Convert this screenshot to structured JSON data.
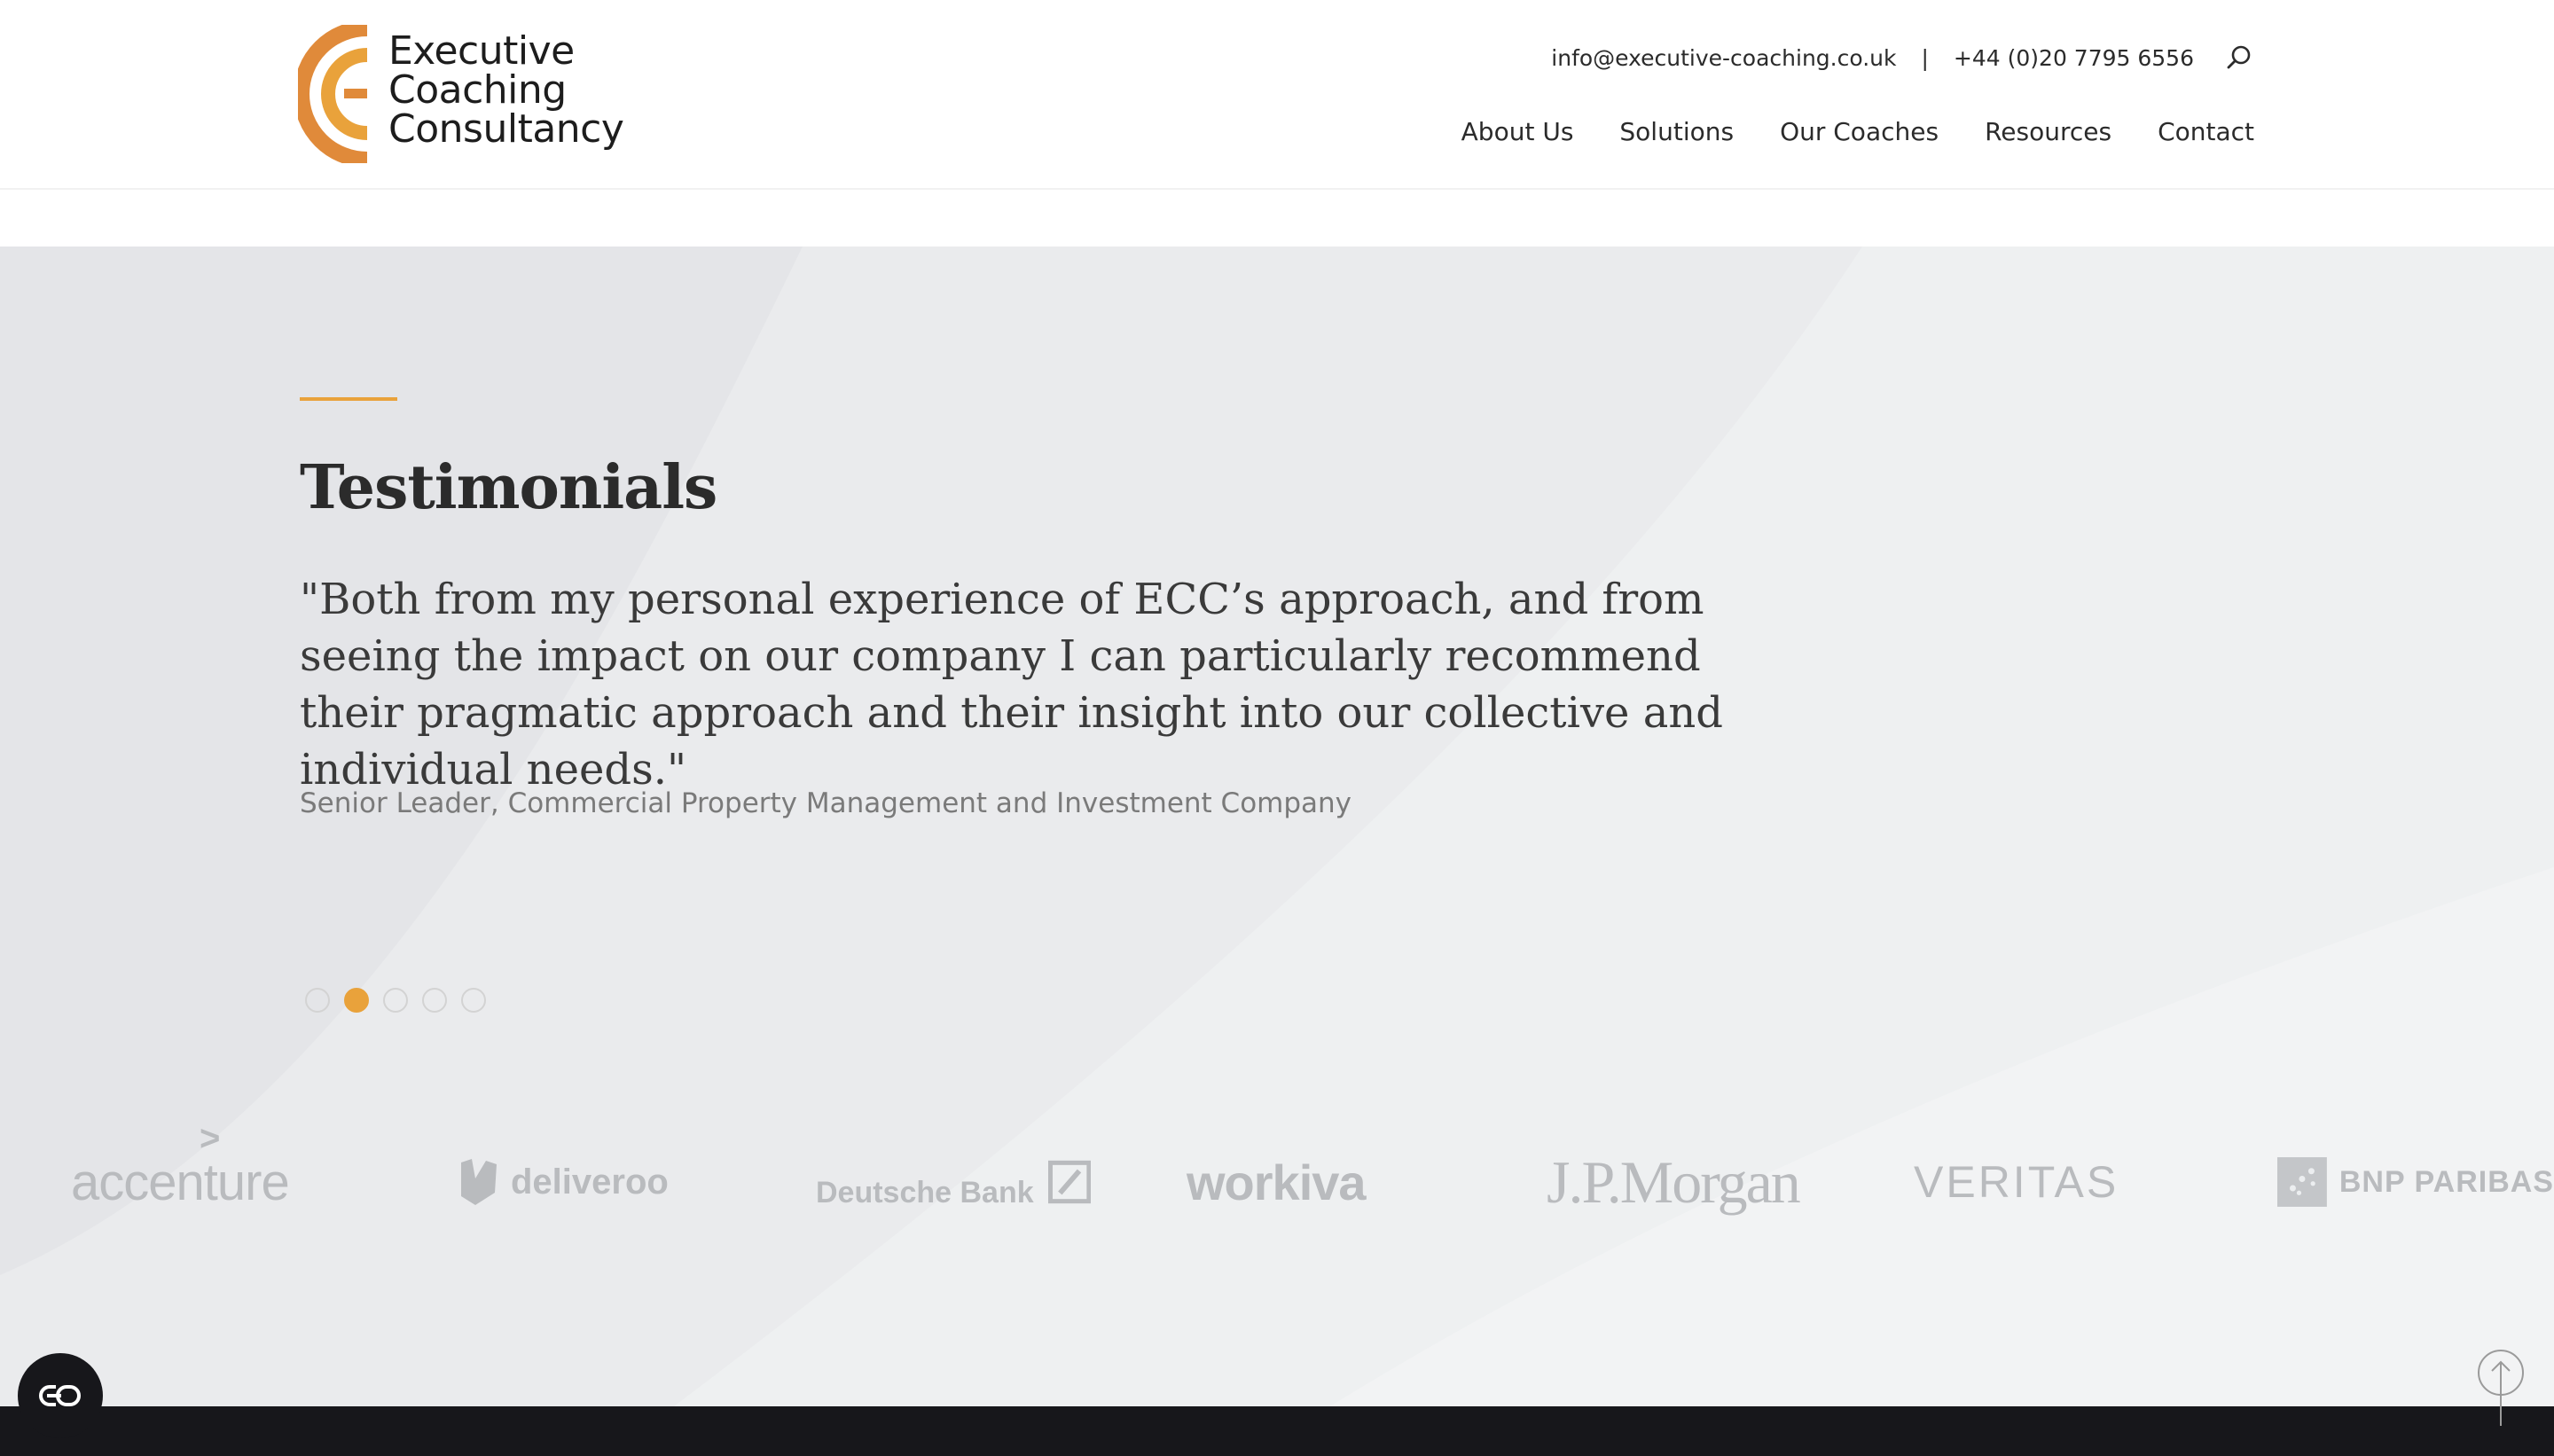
{
  "brand": {
    "line1": "Executive",
    "line2": "Coaching",
    "line3": "Consultancy",
    "colors": {
      "orange": "#e08a3a",
      "gold": "#e9a23b"
    }
  },
  "header": {
    "email": "info@executive-coaching.co.uk",
    "separator": "|",
    "phone": "+44 (0)20 7795 6556",
    "search_icon": "search-icon"
  },
  "nav": {
    "items": [
      {
        "label": "About Us"
      },
      {
        "label": "Solutions"
      },
      {
        "label": "Our Coaches"
      },
      {
        "label": "Resources"
      },
      {
        "label": "Contact"
      }
    ]
  },
  "testimonials": {
    "title": "Testimonials",
    "quote": "\"Both from my personal experience of ECC’s approach, and from seeing the impact on our company I can particularly recommend their pragmatic approach and their insight into our collective and individual needs.\"",
    "author": "Senior Leader, Commercial Property Management and Investment Company",
    "slides_total": 5,
    "active_slide": 2
  },
  "client_logos": {
    "accenture": "accenture",
    "deliveroo": "deliveroo",
    "deutsche_bank": "Deutsche Bank",
    "workiva": "workiva",
    "jpmorgan": "J.P.Morgan",
    "veritas": "VERITAS",
    "bnp_paribas": "BNP PARIBAS"
  },
  "widgets": {
    "accessibility_icon": "accessibility-toggle-icon",
    "back_to_top_icon": "arrow-up-icon"
  }
}
